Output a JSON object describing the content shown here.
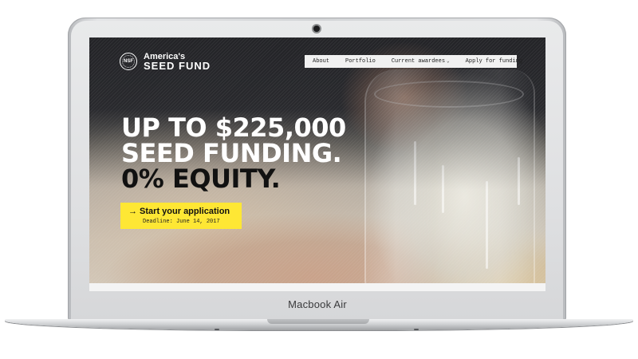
{
  "device": {
    "label": "Macbook Air"
  },
  "site": {
    "logo": {
      "seal_text": "NSF",
      "line1": "America's",
      "line2": "SEED FUND"
    },
    "nav": {
      "items": [
        {
          "label": "About"
        },
        {
          "label": "Portfolio"
        },
        {
          "label": "Current awardees",
          "icon": "chevron-down-icon"
        },
        {
          "label": "Apply for funding"
        }
      ]
    },
    "hero": {
      "line1": "UP TO $225,000",
      "line2": "SEED FUNDING.",
      "line3": "0% EQUITY."
    },
    "cta": {
      "label": "→ Start your application",
      "deadline": "Deadline: June 14, 2017"
    }
  },
  "colors": {
    "cta_yellow": "#fee734",
    "nav_bg": "#f1f1f1",
    "headline_white": "#ffffff",
    "headline_dark": "#111111"
  }
}
